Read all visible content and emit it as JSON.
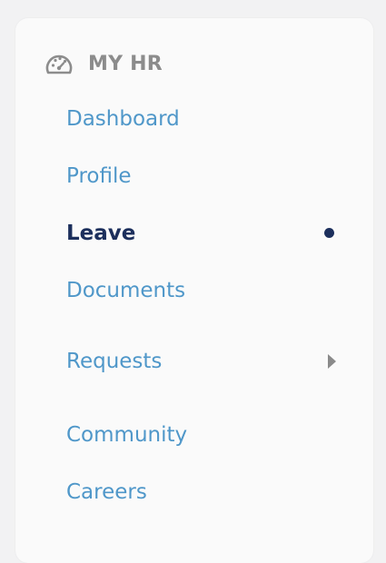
{
  "header": {
    "title": "MY HR",
    "icon": "dashboard-gauge-icon"
  },
  "nav": {
    "items": [
      {
        "label": "Dashboard"
      },
      {
        "label": "Profile"
      },
      {
        "label": "Leave",
        "active": true
      },
      {
        "label": "Documents"
      },
      {
        "label": "Requests",
        "has_submenu": true
      },
      {
        "label": "Community"
      },
      {
        "label": "Careers"
      }
    ]
  },
  "colors": {
    "link": "#4f97c9",
    "active": "#1c2f5c",
    "header": "#8c8c8c",
    "panel_bg": "#fafafa",
    "page_bg": "#f2f2f3"
  }
}
